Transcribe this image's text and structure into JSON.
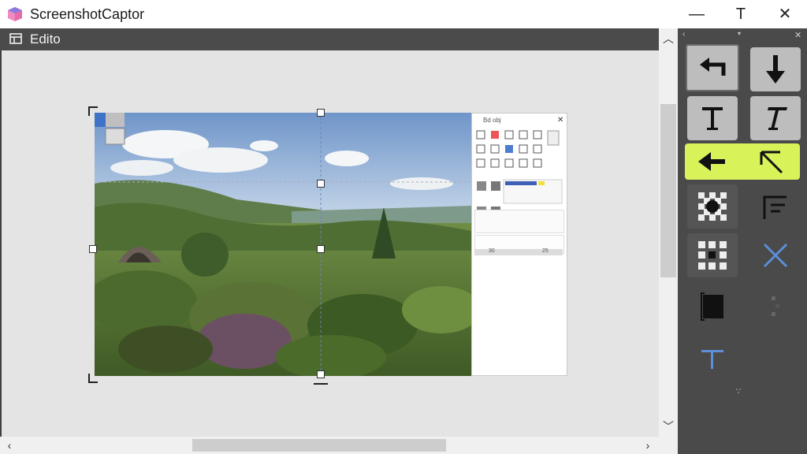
{
  "app": {
    "title": "ScreenshotCaptor",
    "window_buttons": {
      "minimize": "—",
      "topmost": "T",
      "close": "✕"
    }
  },
  "editor": {
    "title": "Edito"
  },
  "embedded_panel": {
    "title": "Bd obj",
    "close": "✕",
    "row_values": {
      "left": "30",
      "right": "25"
    }
  },
  "tools": {
    "header_left": "‹",
    "header_mid": "▾",
    "header_close": "✕",
    "items": [
      {
        "name": "undo-arrow-tool",
        "icon": "left-turn-arrow-icon"
      },
      {
        "name": "down-arrow-tool",
        "icon": "down-arrow-icon"
      },
      {
        "name": "text-tool",
        "icon": "text-t-icon"
      },
      {
        "name": "italic-text-tool",
        "icon": "italic-t-icon"
      },
      {
        "name": "left-arrow-tool",
        "icon": "left-arrow-icon"
      },
      {
        "name": "line-arrow-tool",
        "icon": "diagonal-arrow-icon"
      },
      {
        "name": "pixelate-tool",
        "icon": "pixelate-icon"
      },
      {
        "name": "callout-tool",
        "icon": "callout-icon"
      },
      {
        "name": "grid-tool",
        "icon": "grid-icon"
      },
      {
        "name": "delete-tool",
        "icon": "blue-x-icon"
      },
      {
        "name": "fill-rect-tool",
        "icon": "filled-square-icon"
      },
      {
        "name": "blur-tool",
        "icon": "blur-dots-icon"
      },
      {
        "name": "text-color-tool",
        "icon": "blue-t-icon"
      }
    ],
    "accent": "#d8f25a",
    "blue": "#5b8fd8"
  }
}
